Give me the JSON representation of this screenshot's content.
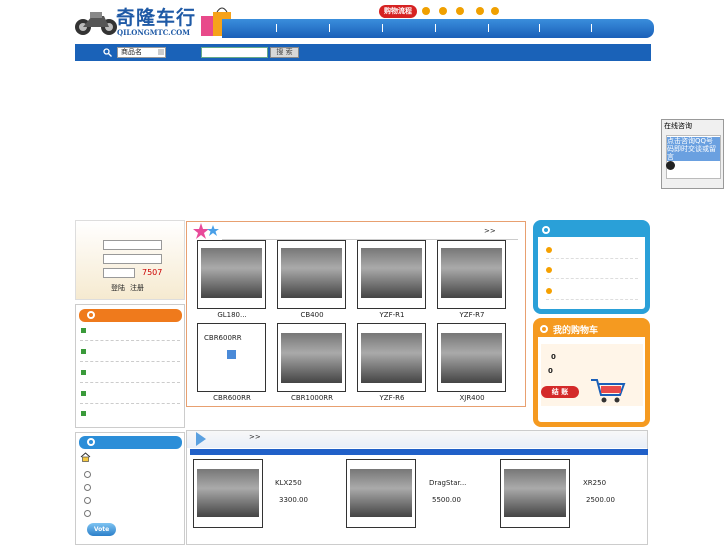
{
  "header": {
    "logo_text": "奇隆车行",
    "logo_sub": "QILONGMTC.COM",
    "flow_label": "购物流程",
    "nav_items": [
      "",
      "",
      "",
      "",
      "",
      "",
      "",
      ""
    ]
  },
  "search": {
    "select_value": "商品名",
    "button_label": "搜 索",
    "input_value": ""
  },
  "consult": {
    "title": "在线咨询",
    "link_text": "点击咨询QQ号码即时交谈或留言"
  },
  "login": {
    "captcha": "7507",
    "buttons": [
      "登陆",
      "注册"
    ]
  },
  "new_products": {
    "more": ">>",
    "items": [
      {
        "name": "GL180..."
      },
      {
        "name": "CB400"
      },
      {
        "name": "YZF-R1"
      },
      {
        "name": "YZF-R7"
      },
      {
        "name": "CBR600RR",
        "no_image": true
      },
      {
        "name": "CBR1000RR"
      },
      {
        "name": "YZF-R6"
      },
      {
        "name": "XJR400"
      }
    ],
    "placeholder_text": "CBR600RR"
  },
  "special": {
    "more": ">>",
    "items": [
      {
        "name": "KLX250",
        "price": "3300.00"
      },
      {
        "name": "DragStar...",
        "price": "5500.00"
      },
      {
        "name": "XR250",
        "price": "2500.00"
      }
    ]
  },
  "vote": {
    "button": "Vote"
  },
  "cart": {
    "title": "我的购物车",
    "count": "0",
    "total": "0",
    "checkout": "结 账"
  }
}
